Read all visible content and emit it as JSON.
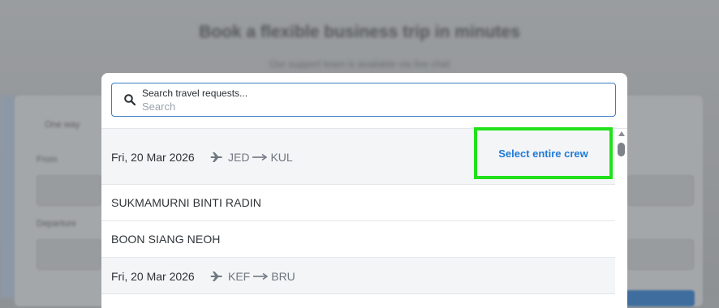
{
  "background": {
    "title": "Book a flexible business trip in minutes",
    "subtitle": "Our support team is available via live chat",
    "tab_label": "One way",
    "from_label": "From",
    "departure_label": "Departure"
  },
  "search": {
    "label": "Search travel requests...",
    "placeholder": "Search",
    "icon": "search-icon"
  },
  "groups": [
    {
      "date": "Fri, 20 Mar 2026",
      "origin": "JED",
      "destination": "KUL",
      "action_label": "Select entire crew",
      "members": [
        "SUKMAMURNI BINTI RADIN",
        "BOON SIANG NEOH"
      ]
    },
    {
      "date": "Fri, 20 Mar 2026",
      "origin": "KEF",
      "destination": "BRU"
    }
  ],
  "colors": {
    "accent": "#1f7bd8",
    "highlight": "#22e01a",
    "search_border": "#3b7fc4"
  }
}
